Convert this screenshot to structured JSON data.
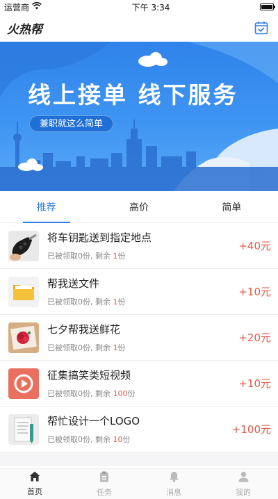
{
  "status_bar": {
    "carrier": "运营商",
    "time": "下午 3:34"
  },
  "header": {
    "logo": "火热帮",
    "right_icon": "calendar-check-icon"
  },
  "banner": {
    "title": "线上接单  线下服务",
    "pill": "兼职就这么简单"
  },
  "tabs": [
    {
      "label": "推荐",
      "active": true
    },
    {
      "label": "高价",
      "active": false
    },
    {
      "label": "简单",
      "active": false
    }
  ],
  "tasks": [
    {
      "title": "将车钥匙送到指定地点",
      "claimed_prefix": "已被领取0份, 剩余 ",
      "remaining": "1",
      "suffix": "份",
      "price": "+40元",
      "icon": "car-key-icon"
    },
    {
      "title": "帮我送文件",
      "claimed_prefix": "已被领取0份, 剩余 ",
      "remaining": "1",
      "suffix": "份",
      "price": "+10元",
      "icon": "folder-icon"
    },
    {
      "title": "七夕帮我送鲜花",
      "claimed_prefix": "已被领取0份, 剩余 ",
      "remaining": "1",
      "suffix": "份",
      "price": "+20元",
      "icon": "flower-box-icon"
    },
    {
      "title": "征集搞笑类短视频",
      "claimed_prefix": "已被领取0份, 剩余 ",
      "remaining": "100",
      "suffix": "份",
      "price": "+10元",
      "icon": "video-play-icon"
    },
    {
      "title": "帮忙设计一个LOGO",
      "claimed_prefix": "已被领取0份, 剩余 ",
      "remaining": "10",
      "suffix": "份",
      "price": "+100元",
      "icon": "design-document-icon"
    }
  ],
  "bottom_nav": [
    {
      "label": "首页",
      "icon": "home-icon",
      "active": true
    },
    {
      "label": "任务",
      "icon": "task-icon",
      "active": false
    },
    {
      "label": "消息",
      "icon": "bell-icon",
      "active": false
    },
    {
      "label": "我的",
      "icon": "user-icon",
      "active": false
    }
  ],
  "colors": {
    "accent": "#2f7fe0",
    "price": "#e05a4a",
    "banner": "#3f95f2"
  }
}
